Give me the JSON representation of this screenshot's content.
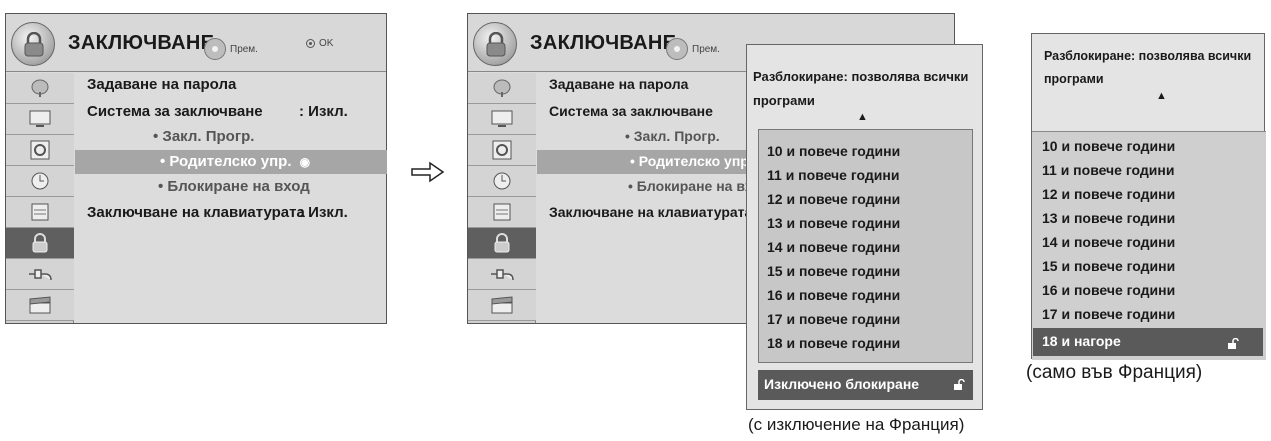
{
  "menu": {
    "title": "ЗАКЛЮЧВАНЕ",
    "hint_move": "Прем.",
    "hint_ok": "OK",
    "items": [
      "Задаване на парола",
      "Система за заключване",
      "• Закл. Прогр.",
      "• Родителско упр.",
      "• Блокиране на вход",
      "Заключване на клавиатурата"
    ],
    "item_values": [
      ": Изкл.",
      ": Изкл."
    ],
    "sidebar_icons": [
      "satellite-dish-icon",
      "monitor-icon",
      "speaker-icon",
      "clock-icon",
      "picture-icon",
      "lock-icon",
      "plug-icon",
      "clapperboard-icon"
    ],
    "selected_index": 3
  },
  "dropdown": {
    "title": "Разблокиране: позволява всички програми",
    "items": [
      "10 и повече години",
      "11 и повече години",
      "12 и повече години",
      "13 и повече години",
      "14 и повече години",
      "15 и повече години",
      "16 и повече години",
      "17 и повече години",
      "18 и повече години"
    ],
    "footer": "Изключено блокиране",
    "caption": "(с изключение на Франция)"
  },
  "france": {
    "title": "Разблокиране: позволява всички програми",
    "items": [
      "10 и повече години",
      "11 и повече години",
      "12 и повече години",
      "13 и повече години",
      "14 и повече години",
      "15 и повече години",
      "16 и повече години",
      "17 и повече години"
    ],
    "selected": "18 и нагоре",
    "caption": "(само във Франция)"
  }
}
